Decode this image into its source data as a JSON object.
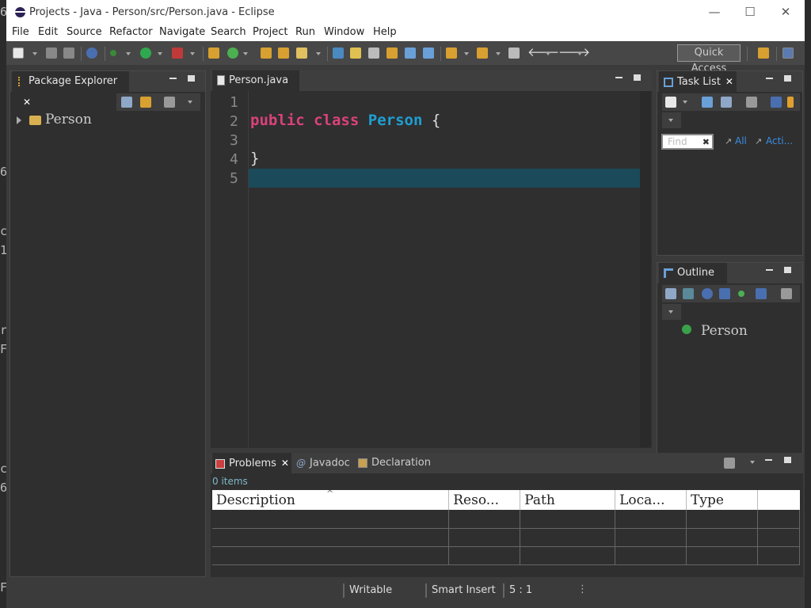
{
  "window": {
    "title": "Projects - Java - Person/src/Person.java - Eclipse"
  },
  "menu": [
    "File",
    "Edit",
    "Source",
    "Refactor",
    "Navigate",
    "Search",
    "Project",
    "Run",
    "Window",
    "Help"
  ],
  "toolbar": {
    "quick_access": "Quick Access"
  },
  "left_strip": [
    "6",
    "6",
    "c",
    "1",
    "r",
    "F",
    "c",
    "6",
    "F"
  ],
  "package_explorer": {
    "tab": "Package Explorer",
    "items": [
      {
        "label": "Person"
      }
    ]
  },
  "editor": {
    "tab": "Person.java",
    "lines": [
      "1",
      "2",
      "3",
      "4",
      "5"
    ],
    "code": {
      "kw1": "public",
      "kw2": "class",
      "classname": "Person",
      "open": " {",
      "close": "}"
    },
    "highlight_color": "#1b4a5a"
  },
  "task_list": {
    "tab": "Task List",
    "find_placeholder": "Find",
    "all": "All",
    "activate": "Acti..."
  },
  "outline": {
    "tab": "Outline",
    "items": [
      {
        "label": "Person"
      }
    ]
  },
  "bottom": {
    "tabs": {
      "problems": "Problems",
      "javadoc": "Javadoc",
      "declaration": "Declaration"
    },
    "count": "0 items",
    "columns": [
      "Description",
      "Reso...",
      "Path",
      "Loca...",
      "Type"
    ]
  },
  "status": {
    "writable": "Writable",
    "insert_mode": "Smart Insert",
    "position": "5 : 1"
  },
  "colors": {
    "keyword": "#d9427a",
    "classname": "#1e9fd2",
    "link": "#3a8ee6"
  }
}
